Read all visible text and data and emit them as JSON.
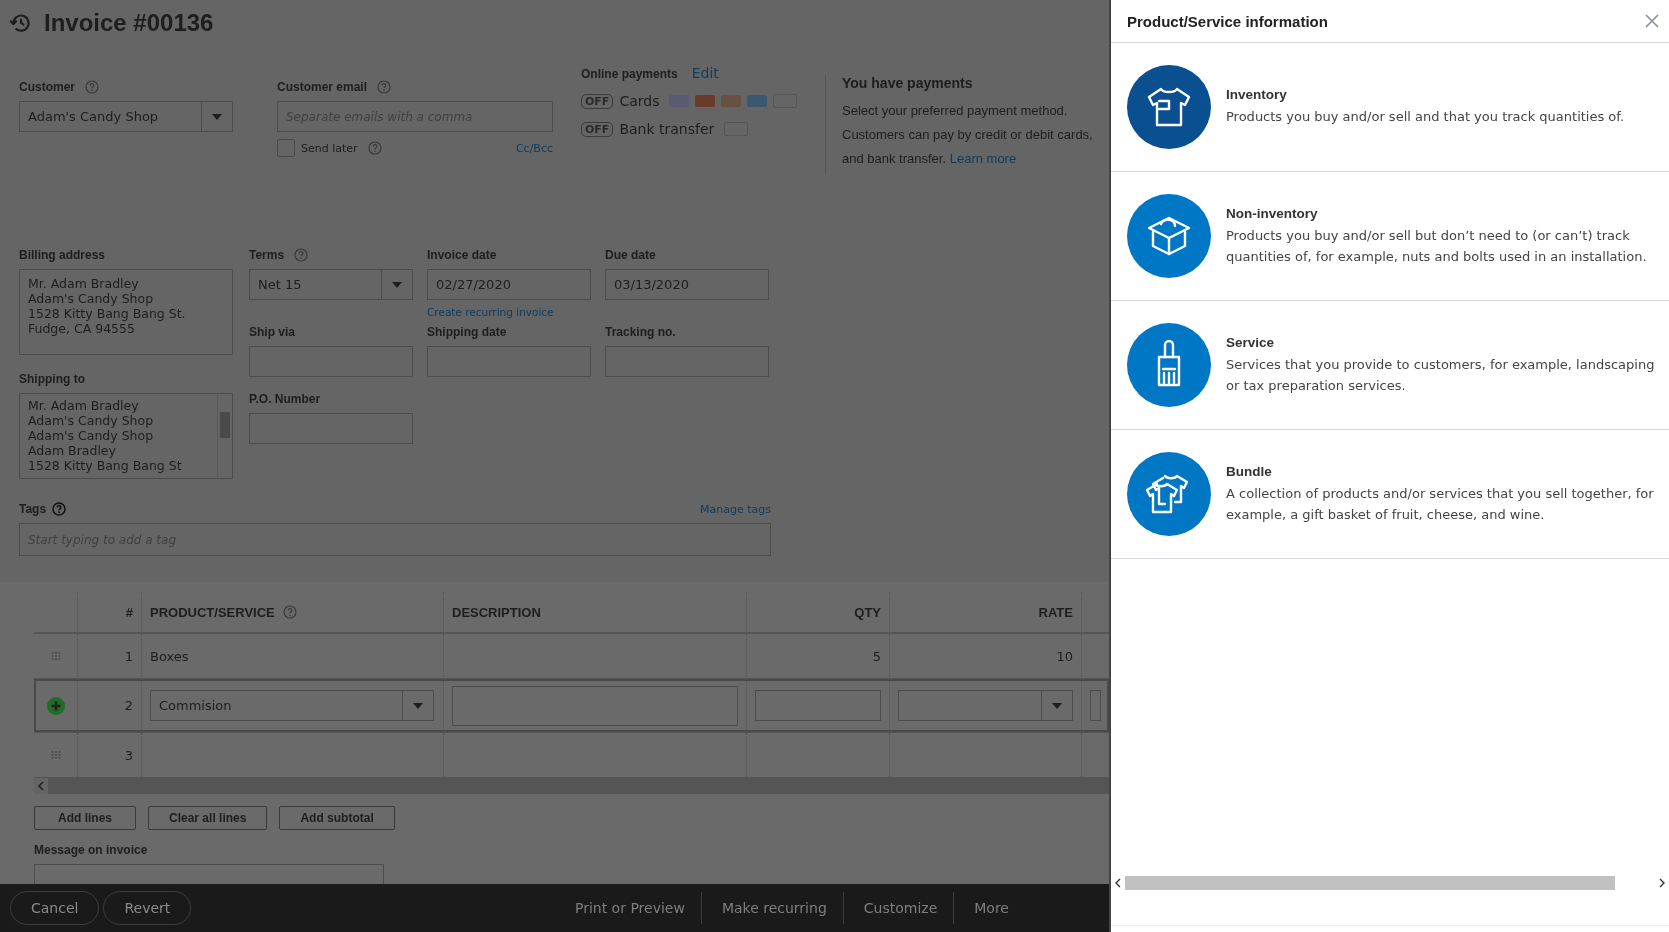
{
  "invoice": {
    "title": "Invoice #00136"
  },
  "customer": {
    "label": "Customer",
    "value": "Adam's Candy Shop"
  },
  "customer_email": {
    "label": "Customer email",
    "placeholder": "Separate emails with a comma",
    "cc_bcc": "Cc/Bcc"
  },
  "send_later": {
    "label": "Send later",
    "checked": false
  },
  "online_payments": {
    "label": "Online payments",
    "edit": "Edit",
    "methods": [
      {
        "kind": "cards",
        "toggle": "OFF",
        "on": false,
        "name": "Cards"
      },
      {
        "kind": "bank",
        "toggle": "OFF",
        "on": false,
        "name": "Bank transfer"
      }
    ]
  },
  "payments_note": {
    "title": "You have payments",
    "text": "Select your preferred payment method. Customers can pay by credit or debit cards, and bank transfer.",
    "link": "Learn more"
  },
  "billing_address": {
    "label": "Billing address",
    "lines": [
      "Mr. Adam Bradley",
      "Adam's Candy Shop",
      "1528 Kitty Bang Bang St.",
      "Fudge, CA  94555"
    ]
  },
  "terms": {
    "label": "Terms",
    "value": "Net 15"
  },
  "invoice_date": {
    "label": "Invoice date",
    "value": "02/27/2020",
    "link": "Create recurring invoice"
  },
  "due_date": {
    "label": "Due date",
    "value": "03/13/2020"
  },
  "shipping_to": {
    "label": "Shipping to",
    "lines": [
      "Mr. Adam Bradley",
      "Adam's Candy Shop",
      "Adam's Candy Shop",
      "Adam Bradley",
      "1528 Kitty Bang Bang St"
    ]
  },
  "ship_via": {
    "label": "Ship via"
  },
  "shipping_date": {
    "label": "Shipping date"
  },
  "tracking_no": {
    "label": "Tracking no."
  },
  "po_number": {
    "label": "P.O. Number"
  },
  "tags": {
    "label": "Tags",
    "manage": "Manage tags",
    "placeholder": "Start typing to add a tag"
  },
  "table": {
    "columns": [
      "#",
      "PRODUCT/SERVICE",
      "DESCRIPTION",
      "QTY",
      "RATE"
    ],
    "rows": [
      {
        "number": "1",
        "product": "Boxes",
        "qty": "5",
        "rate": "10",
        "editing": false
      },
      {
        "number": "2",
        "product": "Commision",
        "editing": true
      },
      {
        "number": "3",
        "editing": false
      }
    ]
  },
  "line_buttons": [
    "Add lines",
    "Clear all lines",
    "Add subtotal"
  ],
  "message": {
    "label": "Message on invoice"
  },
  "footer": {
    "left": [
      "Cancel",
      "Revert"
    ],
    "right": [
      "Print or Preview",
      "Make recurring",
      "Customize",
      "More"
    ]
  },
  "panel": {
    "title": "Product/Service information",
    "items": [
      {
        "kind": "inventory",
        "selected": true,
        "title": "Inventory",
        "text": "Products you buy and/or sell and that you track quantities of."
      },
      {
        "kind": "non_inventory",
        "selected": false,
        "title": "Non-inventory",
        "text": "Products you buy and/or sell but don’t need to (or can’t) track quantities of, for example, nuts and bolts used in an installation."
      },
      {
        "kind": "service",
        "selected": false,
        "title": "Service",
        "text": "Services that you provide to customers, for example, landscaping or tax preparation services."
      },
      {
        "kind": "bundle",
        "selected": false,
        "title": "Bundle",
        "text": "A collection of products and/or services that you sell together, for example, a gift basket of fruit, cheese, and wine."
      }
    ]
  }
}
